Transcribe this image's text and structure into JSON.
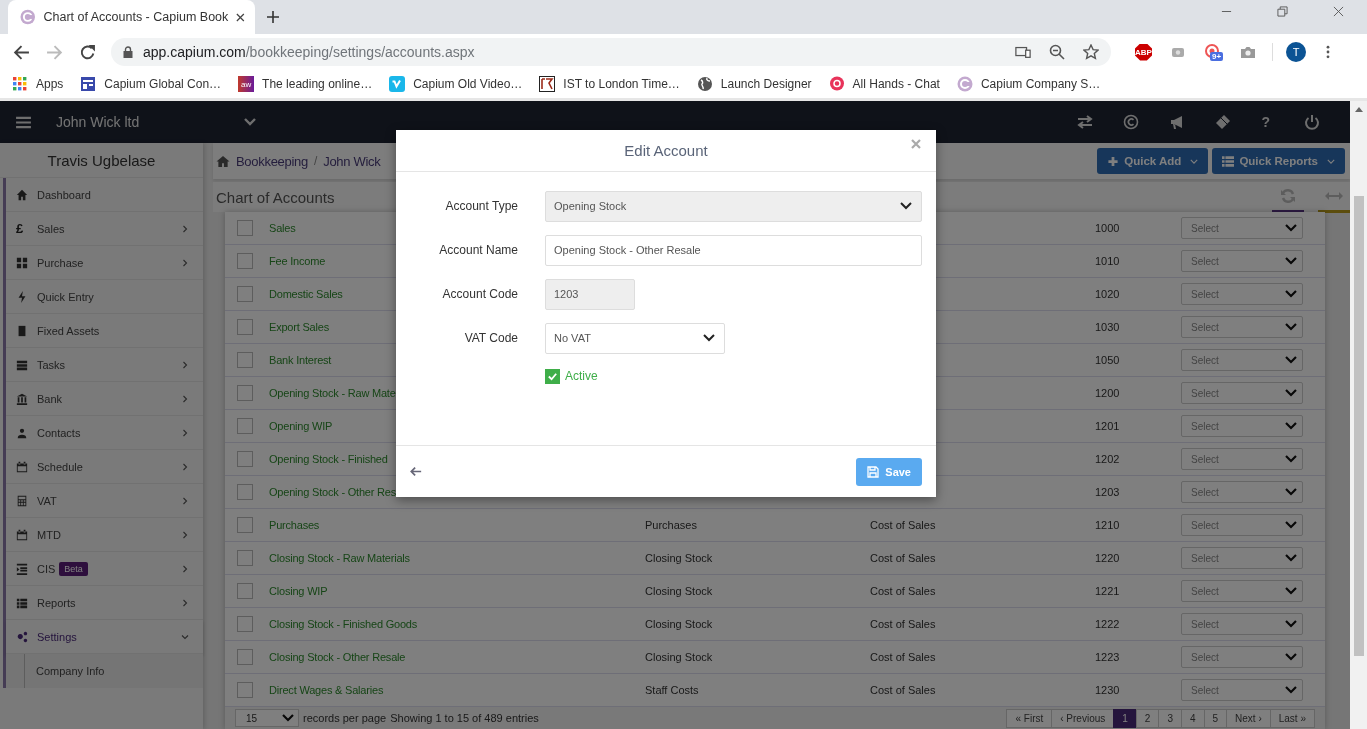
{
  "browser": {
    "tab": {
      "title": "Chart of Accounts - Capium Book"
    },
    "url": {
      "host": "app.capium.com",
      "path": "/bookkeeping/settings/accounts.aspx"
    },
    "extensions": [
      {
        "kind": "abp",
        "label": "ABP"
      },
      {
        "kind": "plain"
      },
      {
        "kind": "counter",
        "badge": "9+"
      },
      {
        "kind": "camera"
      }
    ],
    "avatar": "T",
    "bookmarks": [
      {
        "kind": "apps",
        "label": "Apps"
      },
      {
        "kind": "layout",
        "label": "Capium Global Con…"
      },
      {
        "kind": "aw",
        "label": "The leading online…",
        "icon_text": "aw"
      },
      {
        "kind": "vimeo",
        "label": "Capium Old Video…"
      },
      {
        "kind": "boxed",
        "label": "IST to London Time…"
      },
      {
        "kind": "globe",
        "label": "Launch Designer"
      },
      {
        "kind": "chat",
        "label": "All Hands - Chat"
      },
      {
        "kind": "capium",
        "label": "Capium Company S…"
      }
    ]
  },
  "app": {
    "company": "John Wick ltd",
    "help": "?",
    "user": "Travis Ugbelase",
    "nav": [
      {
        "label": "Dashboard",
        "kind": "link",
        "selected": false
      },
      {
        "label": "Sales",
        "kind": "group",
        "expanded": false,
        "selected": false,
        "icon_text": "£"
      },
      {
        "label": "Purchase",
        "kind": "group",
        "expanded": false,
        "selected": false
      },
      {
        "label": "Quick Entry",
        "kind": "link",
        "selected": false
      },
      {
        "label": "Fixed Assets",
        "kind": "link",
        "selected": false
      },
      {
        "label": "Tasks",
        "kind": "group",
        "expanded": false,
        "selected": false
      },
      {
        "label": "Bank",
        "kind": "group",
        "expanded": false,
        "selected": false
      },
      {
        "label": "Contacts",
        "kind": "group",
        "expanded": false,
        "selected": false
      },
      {
        "label": "Schedule",
        "kind": "group",
        "expanded": false,
        "selected": false
      },
      {
        "label": "VAT",
        "kind": "group",
        "expanded": false,
        "selected": false
      },
      {
        "label": "MTD",
        "kind": "group",
        "expanded": false,
        "selected": false
      },
      {
        "label": "CIS",
        "kind": "group",
        "expanded": false,
        "selected": false,
        "badge": "Beta"
      },
      {
        "label": "Reports",
        "kind": "group",
        "expanded": false,
        "selected": false
      },
      {
        "label": "Settings",
        "kind": "group",
        "expanded": true,
        "selected": true,
        "children": [
          {
            "label": "Company Info",
            "selected": false
          }
        ]
      }
    ],
    "breadcrumb": {
      "items": [
        "Bookkeeping",
        "John Wick"
      ],
      "separator": "/"
    },
    "buttons": [
      {
        "kind": "add",
        "label": "Quick Add"
      },
      {
        "kind": "reports",
        "label": "Quick Reports"
      }
    ],
    "page_title": "Chart of Accounts",
    "table": {
      "rows": [
        {
          "checked": false,
          "name": "Sales",
          "code": "1000",
          "select": "Select"
        },
        {
          "checked": false,
          "name": "Fee Income",
          "code": "1010",
          "select": "Select"
        },
        {
          "checked": false,
          "name": "Domestic Sales",
          "code": "1020",
          "select": "Select"
        },
        {
          "checked": false,
          "name": "Export Sales",
          "code": "1030",
          "select": "Select"
        },
        {
          "checked": false,
          "name": "Bank Interest",
          "code": "1050",
          "select": "Select"
        },
        {
          "checked": false,
          "name": "Opening Stock - Raw Mate",
          "code": "1200",
          "select": "Select"
        },
        {
          "checked": false,
          "name": "Opening WIP",
          "code": "1201",
          "select": "Select"
        },
        {
          "checked": false,
          "name": "Opening Stock - Finished",
          "code": "1202",
          "select": "Select"
        },
        {
          "checked": false,
          "name": "Opening Stock - Other Res",
          "code": "1203",
          "select": "Select"
        },
        {
          "checked": false,
          "name": "Purchases",
          "column_2": "Purchases",
          "column_3": "Cost of Sales",
          "code": "1210",
          "select": "Select"
        },
        {
          "checked": false,
          "name": "Closing Stock - Raw Materials",
          "column_2": "Closing Stock",
          "column_3": "Cost of Sales",
          "code": "1220",
          "select": "Select"
        },
        {
          "checked": false,
          "name": "Closing WIP",
          "column_2": "Closing Stock",
          "column_3": "Cost of Sales",
          "code": "1221",
          "select": "Select"
        },
        {
          "checked": false,
          "name": "Closing Stock - Finished Goods",
          "column_2": "Closing Stock",
          "column_3": "Cost of Sales",
          "code": "1222",
          "select": "Select"
        },
        {
          "checked": false,
          "name": "Closing Stock - Other Resale",
          "column_2": "Closing Stock",
          "column_3": "Cost of Sales",
          "code": "1223",
          "select": "Select"
        },
        {
          "checked": false,
          "name": "Direct Wages & Salaries",
          "column_2": "Staff Costs",
          "column_3": "Cost of Sales",
          "code": "1230",
          "select": "Select"
        }
      ]
    },
    "footer": {
      "page_size": "15",
      "page_size_label": "records per page",
      "info": "Showing 1 to 15 of 489 entries",
      "pages": [
        {
          "label": "« First",
          "selected": false
        },
        {
          "label": "‹ Previous",
          "selected": false
        },
        {
          "label": "1",
          "selected": true
        },
        {
          "label": "2",
          "selected": false
        },
        {
          "label": "3",
          "selected": false
        },
        {
          "label": "4",
          "selected": false
        },
        {
          "label": "5",
          "selected": false
        },
        {
          "label": "Next ›",
          "selected": false
        },
        {
          "label": "Last »",
          "selected": false
        }
      ]
    },
    "modal": {
      "title": "Edit Account",
      "fields": [
        {
          "label": "Account Type",
          "kind": "select-wide",
          "value": "Opening Stock",
          "disabled": true
        },
        {
          "label": "Account Name",
          "kind": "input-wide",
          "value": "Opening Stock - Other Resale",
          "disabled": false
        },
        {
          "label": "Account Code",
          "kind": "input-short",
          "value": "1203",
          "disabled": true
        },
        {
          "label": "VAT Code",
          "kind": "select-short",
          "value": "No VAT",
          "disabled": false
        }
      ],
      "active": {
        "label": "Active",
        "checked": true
      },
      "save": "Save"
    }
  }
}
